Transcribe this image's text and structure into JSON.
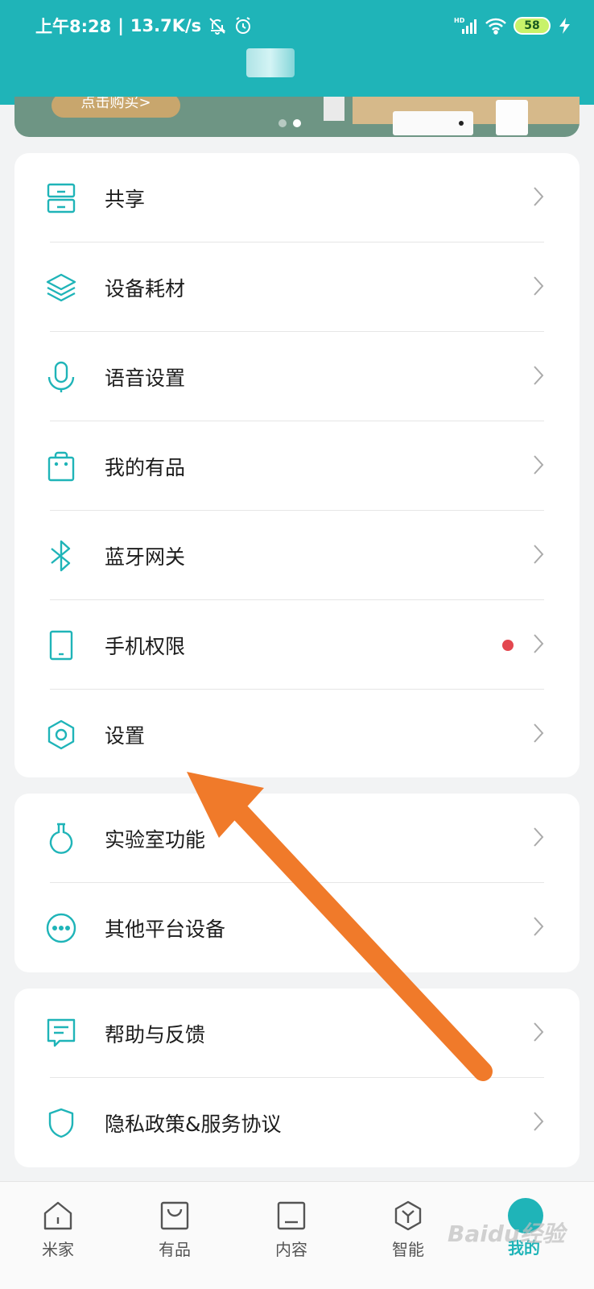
{
  "status_bar": {
    "time": "上午8:28",
    "net_speed": "13.7K/s",
    "battery": "58",
    "network": "HD"
  },
  "banner": {
    "button_label": "点击购买>"
  },
  "groups": [
    {
      "items": [
        {
          "label": "共享",
          "icon": "share-drawer-icon"
        },
        {
          "label": "设备耗材",
          "icon": "layers-icon"
        },
        {
          "label": "语音设置",
          "icon": "microphone-icon"
        },
        {
          "label": "我的有品",
          "icon": "shopping-bag-icon"
        },
        {
          "label": "蓝牙网关",
          "icon": "bluetooth-icon"
        },
        {
          "label": "手机权限",
          "icon": "phone-icon",
          "badge": true
        },
        {
          "label": "设置",
          "icon": "hexagon-settings-icon"
        }
      ]
    },
    {
      "items": [
        {
          "label": "实验室功能",
          "icon": "flask-icon"
        },
        {
          "label": "其他平台设备",
          "icon": "more-dots-icon"
        }
      ]
    },
    {
      "items": [
        {
          "label": "帮助与反馈",
          "icon": "feedback-icon"
        },
        {
          "label": "隐私政策&服务协议",
          "icon": "shield-icon"
        }
      ]
    }
  ],
  "tabs": [
    {
      "label": "米家",
      "icon": "home-icon",
      "active": false
    },
    {
      "label": "有品",
      "icon": "shop-icon",
      "active": false
    },
    {
      "label": "内容",
      "icon": "content-icon",
      "active": false
    },
    {
      "label": "智能",
      "icon": "smart-icon",
      "active": false
    },
    {
      "label": "我的",
      "icon": "profile-icon",
      "active": true
    }
  ],
  "watermark": "Baidu经验",
  "colors": {
    "accent": "#1fb4b8",
    "annotation_arrow": "#f07a2a",
    "badge": "#e3474f"
  }
}
